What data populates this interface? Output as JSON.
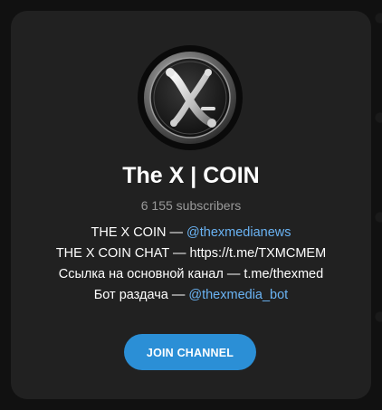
{
  "channel": {
    "title": "The X | COIN",
    "subscribers": "6 155 subscribers",
    "avatar_icon": "x-coin-logo-icon",
    "description": [
      {
        "text": "THE X COIN — ",
        "link": "@thexmedianews"
      },
      {
        "text": "THE X COIN CHAT — https://t.me/TXMCMEM",
        "link": ""
      },
      {
        "text": "Ссылка на основной канал — t.me/thexmed",
        "link": ""
      },
      {
        "text": "Бот раздача — ",
        "link": "@thexmedia_bot"
      }
    ]
  },
  "join_button": {
    "label": "JOIN CHANNEL",
    "color": "#2b8fd6"
  },
  "colors": {
    "card_bg": "#212121",
    "link": "#6ab3f3",
    "muted": "#9a9a9a"
  }
}
